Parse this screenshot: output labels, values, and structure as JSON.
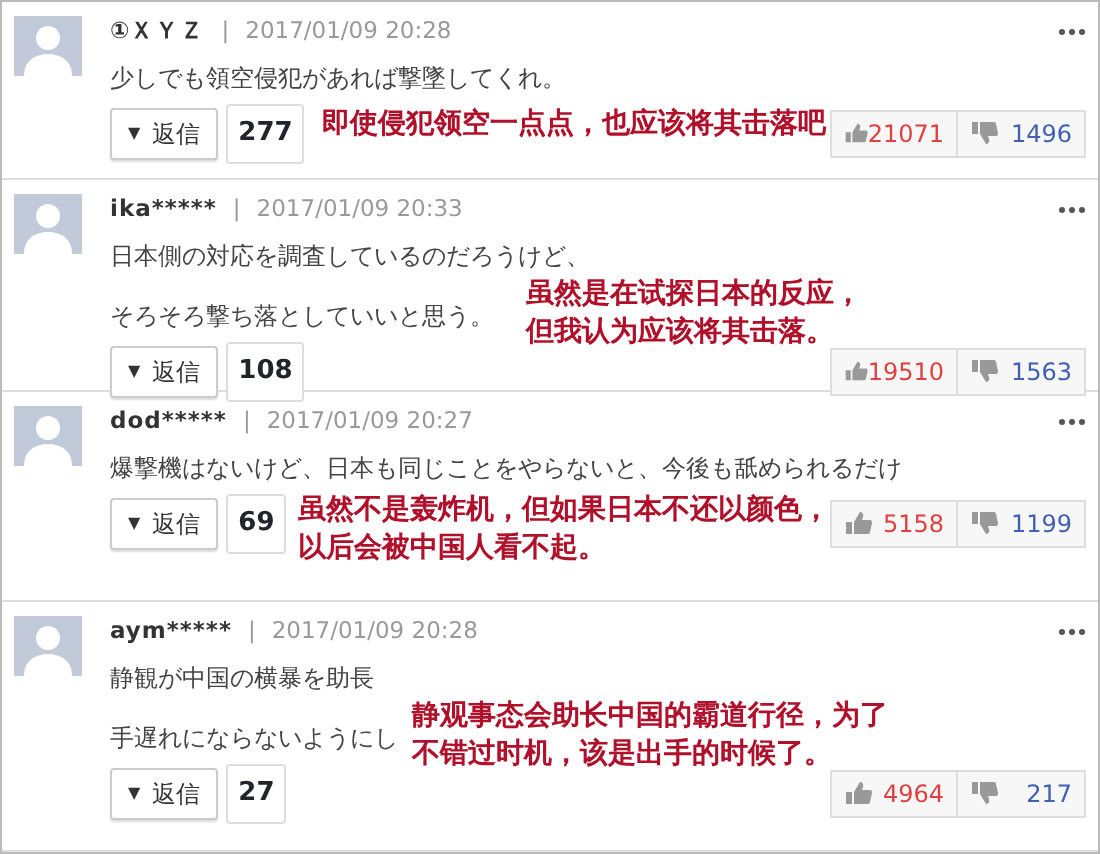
{
  "comments": [
    {
      "user": "①ＸＹＺ",
      "separator": "|",
      "date": "2017/01/09 20:28",
      "lines": [
        "少しでも領空侵犯があれば撃墜してくれ。"
      ],
      "reply": {
        "label": "返信",
        "arrow": "▼"
      },
      "reply_count": "277",
      "likes": "21071",
      "dislikes": "1496",
      "note": [
        "即使侵犯领空一点点，也应该将其击落吧"
      ]
    },
    {
      "user": "ika*****",
      "separator": "|",
      "date": "2017/01/09 20:33",
      "lines": [
        "日本側の対応を調査しているのだろうけど、",
        "そろそろ撃ち落としていいと思う。"
      ],
      "reply": {
        "label": "返信",
        "arrow": "▼"
      },
      "reply_count": "108",
      "likes": "19510",
      "dislikes": "1563",
      "note": [
        "虽然是在试探日本的反应，",
        "但我认为应该将其击落。"
      ]
    },
    {
      "user": "dod*****",
      "separator": "|",
      "date": "2017/01/09 20:27",
      "lines": [
        "爆撃機はないけど、日本も同じことをやらないと、今後も舐められるだけ"
      ],
      "reply": {
        "label": "返信",
        "arrow": "▼"
      },
      "reply_count": "69",
      "likes": "5158",
      "dislikes": "1199",
      "note": [
        "虽然不是轰炸机，但如果日本不还以颜色，",
        "以后会被中国人看不起。"
      ]
    },
    {
      "user": "aym*****",
      "separator": "|",
      "date": "2017/01/09 20:28",
      "lines": [
        "静観が中国の横暴を助長",
        "手遅れにならないようにし"
      ],
      "reply": {
        "label": "返信",
        "arrow": "▼"
      },
      "reply_count": "27",
      "likes": "4964",
      "dislikes": "217",
      "note": [
        "静观事态会助长中国的霸道行径，为了",
        "不错过时机，该是出手的时候了。"
      ]
    }
  ]
}
